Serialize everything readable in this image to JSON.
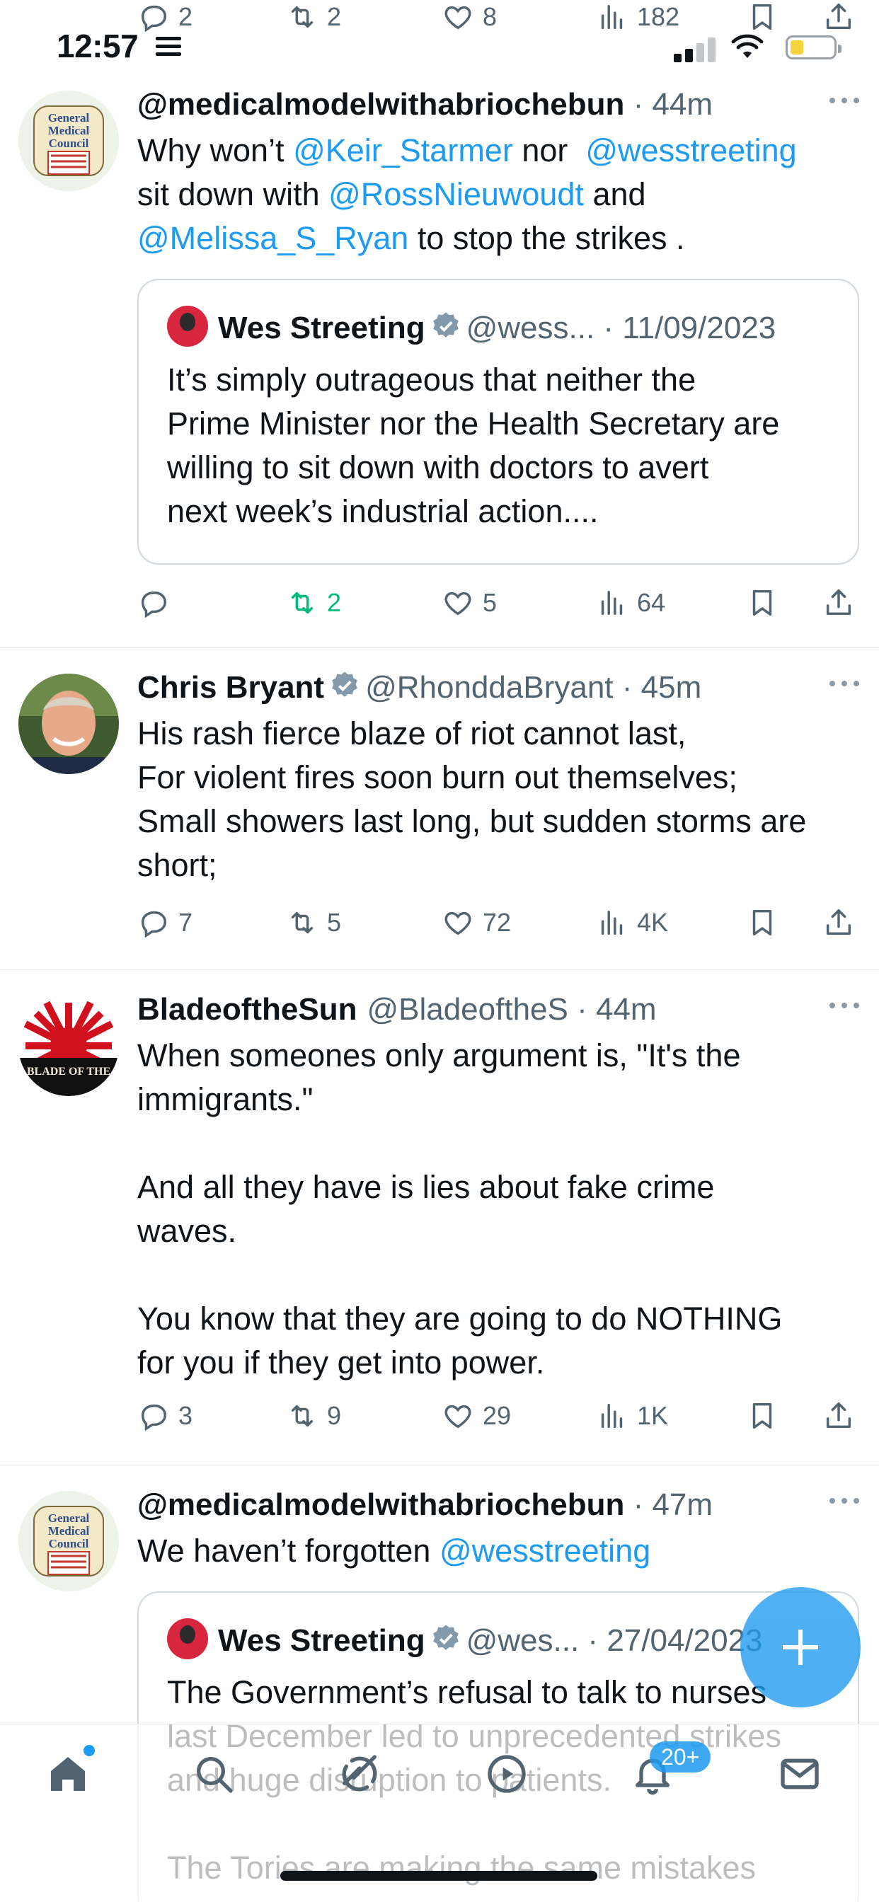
{
  "status_bar": {
    "time": "12:57"
  },
  "top_stats": {
    "reply": "2",
    "retweet": "2",
    "like": "8",
    "views": "182"
  },
  "tweets": [
    {
      "name": "@medicalmodelwithabriochebun",
      "time": "44m",
      "text_parts": [
        "Why won’t ",
        "@Keir_Starmer",
        " nor  ",
        "@wesstreeting",
        "\nsit down with ",
        "@RossNieuwoudt",
        " and\n",
        "@Melissa_S_Ryan",
        " to stop the strikes ."
      ],
      "quote": {
        "name": "Wes Streeting",
        "handle": "@wess...",
        "date": "11/09/2023",
        "text": "It’s simply outrageous that neither the\nPrime Minister nor the Health Secretary are\nwilling to sit down with doctors to avert\nnext week’s industrial action...."
      },
      "stats": {
        "reply": "",
        "retweet": "2",
        "like": "5",
        "views": "64"
      }
    },
    {
      "name": "Chris Bryant",
      "handle": "@RhonddaBryant",
      "time": "45m",
      "text": "His rash fierce blaze of riot cannot last,\nFor violent fires soon burn out themselves;\nSmall showers last long, but sudden storms are\nshort;",
      "stats": {
        "reply": "7",
        "retweet": "5",
        "like": "72",
        "views": "4K"
      }
    },
    {
      "name": "BladeoftheSun",
      "handle": "@BladeoftheS",
      "time": "44m",
      "avatar_text": "BLADE OF THE",
      "text": "When someones only argument is, \"It's the\nimmigrants.\"\n\nAnd all they have is lies about fake crime\nwaves.\n\nYou know that they are going to do NOTHING\nfor you if they get into power.",
      "stats": {
        "reply": "3",
        "retweet": "9",
        "like": "29",
        "views": "1K"
      }
    },
    {
      "name": "@medicalmodelwithabriochebun",
      "time": "47m",
      "text_parts": [
        "We haven’t forgotten ",
        "@wesstreeting"
      ],
      "quote": {
        "name": "Wes Streeting",
        "handle": "@wes...",
        "date": "27/04/2023",
        "text": "The Government’s refusal to talk to nurses\nlast December led to unprecedented strikes\nand huge disruption to patients.\n\nThe Tories are making the same mistakes"
      }
    }
  ],
  "gmc_avatar_text": "General Medical Council",
  "tabbar": {
    "notifications_badge": "20+"
  },
  "colors": {
    "accent": "#1d9bf0",
    "retweet_active": "#00ba7c",
    "secondary_text": "#536471"
  }
}
